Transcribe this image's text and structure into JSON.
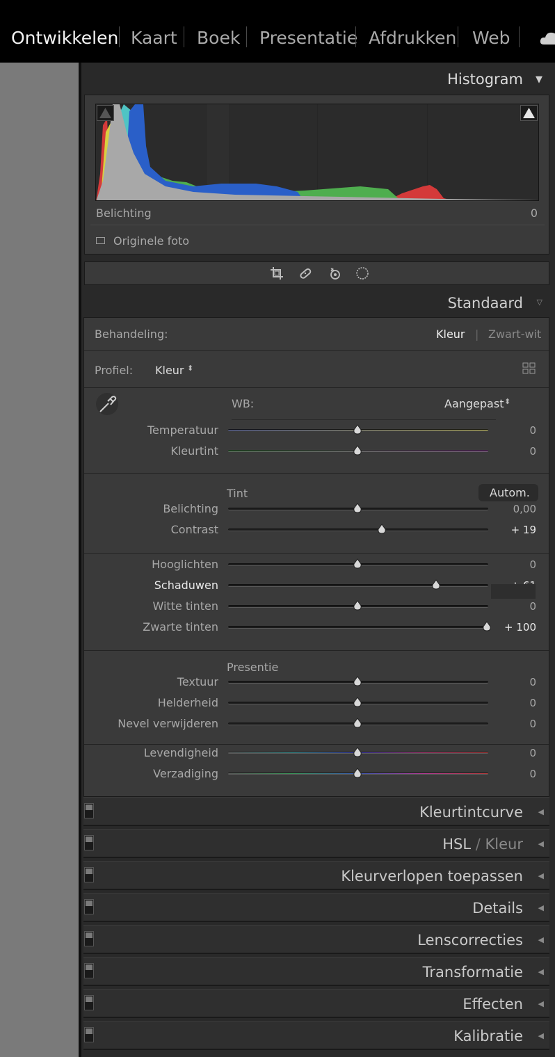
{
  "modules": [
    "Ontwikkelen",
    "Kaart",
    "Boek",
    "Presentatie",
    "Afdrukken",
    "Web"
  ],
  "histogram": {
    "title": "Histogram",
    "readout_label": "Belichting",
    "readout_value": "0",
    "original_photo": "Originele foto"
  },
  "basic": {
    "title": "Standaard",
    "treatment_label": "Behandeling:",
    "treatment_color": "Kleur",
    "treatment_bw": "Zwart-wit",
    "profile_label": "Profiel:",
    "profile_value": "Kleur",
    "wb_label": "WB:",
    "wb_value": "Aangepast",
    "tone_label": "Tint",
    "auto_button": "Autom.",
    "presence_label": "Presentie",
    "sliders": [
      {
        "label": "Temperatuur",
        "value": "0",
        "pos": 0.5
      },
      {
        "label": "Kleurtint",
        "value": "0",
        "pos": 0.5
      },
      {
        "label": "Belichting",
        "value": "0,00",
        "pos": 0.5
      },
      {
        "label": "Contrast",
        "value": "+ 19",
        "pos": 0.595
      },
      {
        "label": "Hooglichten",
        "value": "0",
        "pos": 0.5
      },
      {
        "label": "Schaduwen",
        "value": "+ 61",
        "pos": 0.805
      },
      {
        "label": "Witte tinten",
        "value": "0",
        "pos": 0.5
      },
      {
        "label": "Zwarte tinten",
        "value": "+ 100",
        "pos": 1.0
      },
      {
        "label": "Textuur",
        "value": "0",
        "pos": 0.5
      },
      {
        "label": "Helderheid",
        "value": "0",
        "pos": 0.5
      },
      {
        "label": "Nevel verwijderen",
        "value": "0",
        "pos": 0.5
      },
      {
        "label": "Levendigheid",
        "value": "0",
        "pos": 0.5
      },
      {
        "label": "Verzadiging",
        "value": "0",
        "pos": 0.5
      }
    ]
  },
  "sections": {
    "tone_curve": "Kleurtintcurve",
    "hsl": "HSL",
    "hsl_sep": "/",
    "hsl_color": "Kleur",
    "color_grading": "Kleurverlopen toepassen",
    "details": "Details",
    "lens": "Lenscorrecties",
    "transform": "Transformatie",
    "effects": "Effecten",
    "calibration": "Kalibratie"
  },
  "icons": [
    "crop-icon",
    "healing-icon",
    "redeye-icon",
    "masking-icon",
    "cloud-icon",
    "eyedropper-icon",
    "grid-icon"
  ]
}
